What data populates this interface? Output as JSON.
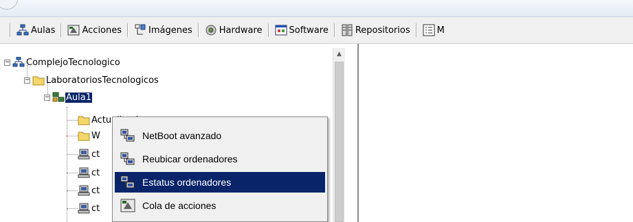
{
  "toolbar": {
    "items": [
      {
        "label": "Aulas",
        "icon": "aulas-icon"
      },
      {
        "label": "Acciones",
        "icon": "acciones-icon"
      },
      {
        "label": "Imágenes",
        "icon": "imagenes-icon"
      },
      {
        "label": "Hardware",
        "icon": "hardware-icon"
      },
      {
        "label": "Software",
        "icon": "software-icon"
      },
      {
        "label": "Repositorios",
        "icon": "repositorios-icon"
      },
      {
        "label": "M",
        "icon": "menus-icon"
      }
    ]
  },
  "tree": {
    "root": "ComplejoTecnologico",
    "group": "LaboratoriosTecnologicos",
    "classroom": "Aula1",
    "folder1": "ActualizarImagen",
    "folder2": "W",
    "computers": [
      "ct",
      "ct",
      "ct",
      "ct"
    ]
  },
  "context_menu": {
    "items": [
      {
        "label": "NetBoot avanzado",
        "icon": "netboot-icon"
      },
      {
        "label": "Reubicar ordenadores",
        "icon": "relocate-icon"
      },
      {
        "label": "Estatus ordenadores",
        "icon": "status-icon",
        "highlighted": true
      },
      {
        "label": "Cola de acciones",
        "icon": "queue-icon"
      }
    ]
  },
  "colors": {
    "selection": "#0a246a",
    "toolbar_bg": "#f0f0f0"
  }
}
